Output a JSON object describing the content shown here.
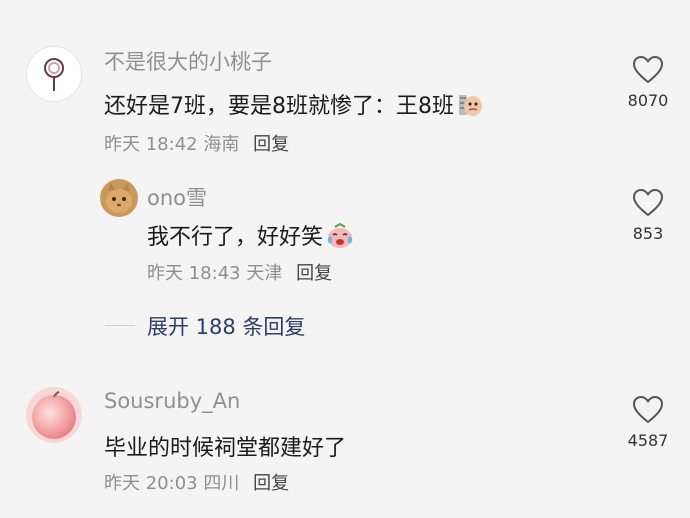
{
  "comments": [
    {
      "username": "不是很大的小桃子",
      "text": "还好是7班，要是8班就惨了：王8班",
      "time": "昨天 18:42",
      "location": "海南",
      "reply_label": "回复",
      "like_count": "8070",
      "avatar_icon": "lollipop-avatar-icon",
      "emoji_icon": "zombie-face-emoji-icon"
    },
    {
      "username": "ono雪",
      "text": "我不行了，好好笑",
      "time": "昨天 18:43",
      "location": "天津",
      "reply_label": "回复",
      "like_count": "853",
      "avatar_icon": "cat-avatar-icon",
      "emoji_icon": "laugh-cry-emoji-icon"
    },
    {
      "username": "Sousruby_An",
      "text": "毕业的时候祠堂都建好了",
      "time": "昨天 20:03",
      "location": "四川",
      "reply_label": "回复",
      "like_count": "4587",
      "avatar_icon": "peach-avatar-icon"
    }
  ],
  "expand_replies": {
    "label": "展开 188 条回复"
  },
  "colors": {
    "background": "#f4f4f4",
    "link": "#2c3e66",
    "muted": "#8f8f8f"
  }
}
